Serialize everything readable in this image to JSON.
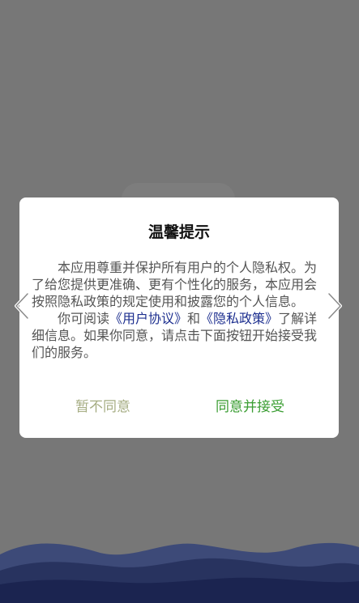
{
  "dialog": {
    "title": "温馨提示",
    "paragraph1": "本应用尊重并保护所有用户的个人隐私权。为了给您提供更准确、更有个性化的服务，本应用会按照隐私政策的规定使用和披露您的个人信息。",
    "paragraph2_prefix": "你可阅读",
    "user_agreement_link": "《用户协议》",
    "conjunction": "和",
    "privacy_policy_link": "《隐私政策》",
    "paragraph2_suffix": "了解详细信息。如果你同意，请点击下面按钮开始接受我们的服务。",
    "decline_label": "暂不同意",
    "accept_label": "同意并接受"
  },
  "colors": {
    "backdrop": "#777777",
    "accept": "#3a9d32",
    "decline": "#a6ad83",
    "link": "#1d2f8f",
    "wave_dark": "#1b2450"
  },
  "icons": {
    "left": "chevron-left-icon",
    "right": "chevron-right-icon"
  }
}
